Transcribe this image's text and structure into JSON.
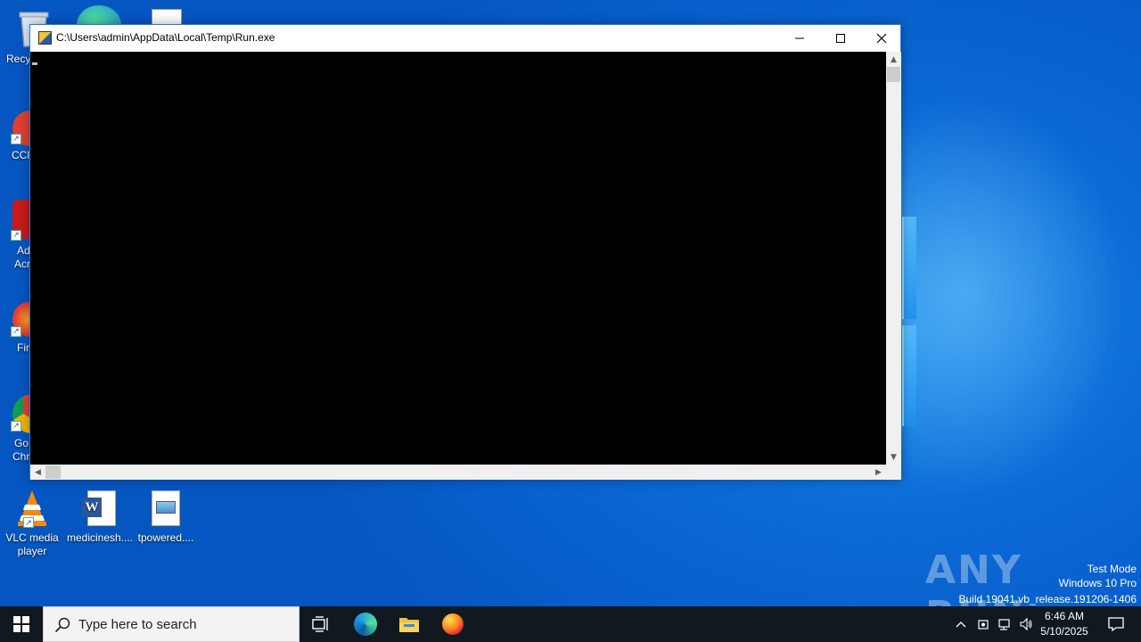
{
  "window": {
    "title": "C:\\Users\\admin\\AppData\\Local\\Temp\\Run.exe",
    "icon": "console-app-icon",
    "controls": [
      "minimize-icon",
      "maximize-icon",
      "close-icon"
    ]
  },
  "desktop": {
    "icons": [
      {
        "name": "recycle-bin",
        "label": "Recy",
        "icon": "recycle-bin-icon"
      },
      {
        "name": "ccleaner",
        "label": "CCl",
        "icon": "ccleaner-icon"
      },
      {
        "name": "adobe-acrobat",
        "label": "Ad",
        "label2": "Acr",
        "icon": "acrobat-icon"
      },
      {
        "name": "firefox",
        "label": "Fir",
        "icon": "firefox-icon"
      },
      {
        "name": "google-chrome",
        "label": "Go",
        "label2": "Chr",
        "icon": "chrome-icon"
      },
      {
        "name": "vlc",
        "label": "VLC media player",
        "icon": "vlc-icon"
      },
      {
        "name": "medicinesh",
        "label": "medicinesh....",
        "icon": "word-document-icon"
      },
      {
        "name": "tpowered",
        "label": "tpowered....",
        "icon": "image-file-icon"
      }
    ]
  },
  "watermark": {
    "brand": "ANY RUN",
    "line1": "Test Mode",
    "line2": "Windows 10 Pro",
    "line3": "Build 19041.vb_release.191206-1406"
  },
  "taskbar": {
    "search_placeholder": "Type here to search",
    "apps": [
      "task-view-icon",
      "edge-icon",
      "file-explorer-icon",
      "firefox-icon"
    ],
    "tray": [
      "chevron-up-icon",
      "security-icon",
      "network-icon",
      "volume-icon"
    ],
    "time": "6:46 AM",
    "date": "5/10/2025"
  }
}
